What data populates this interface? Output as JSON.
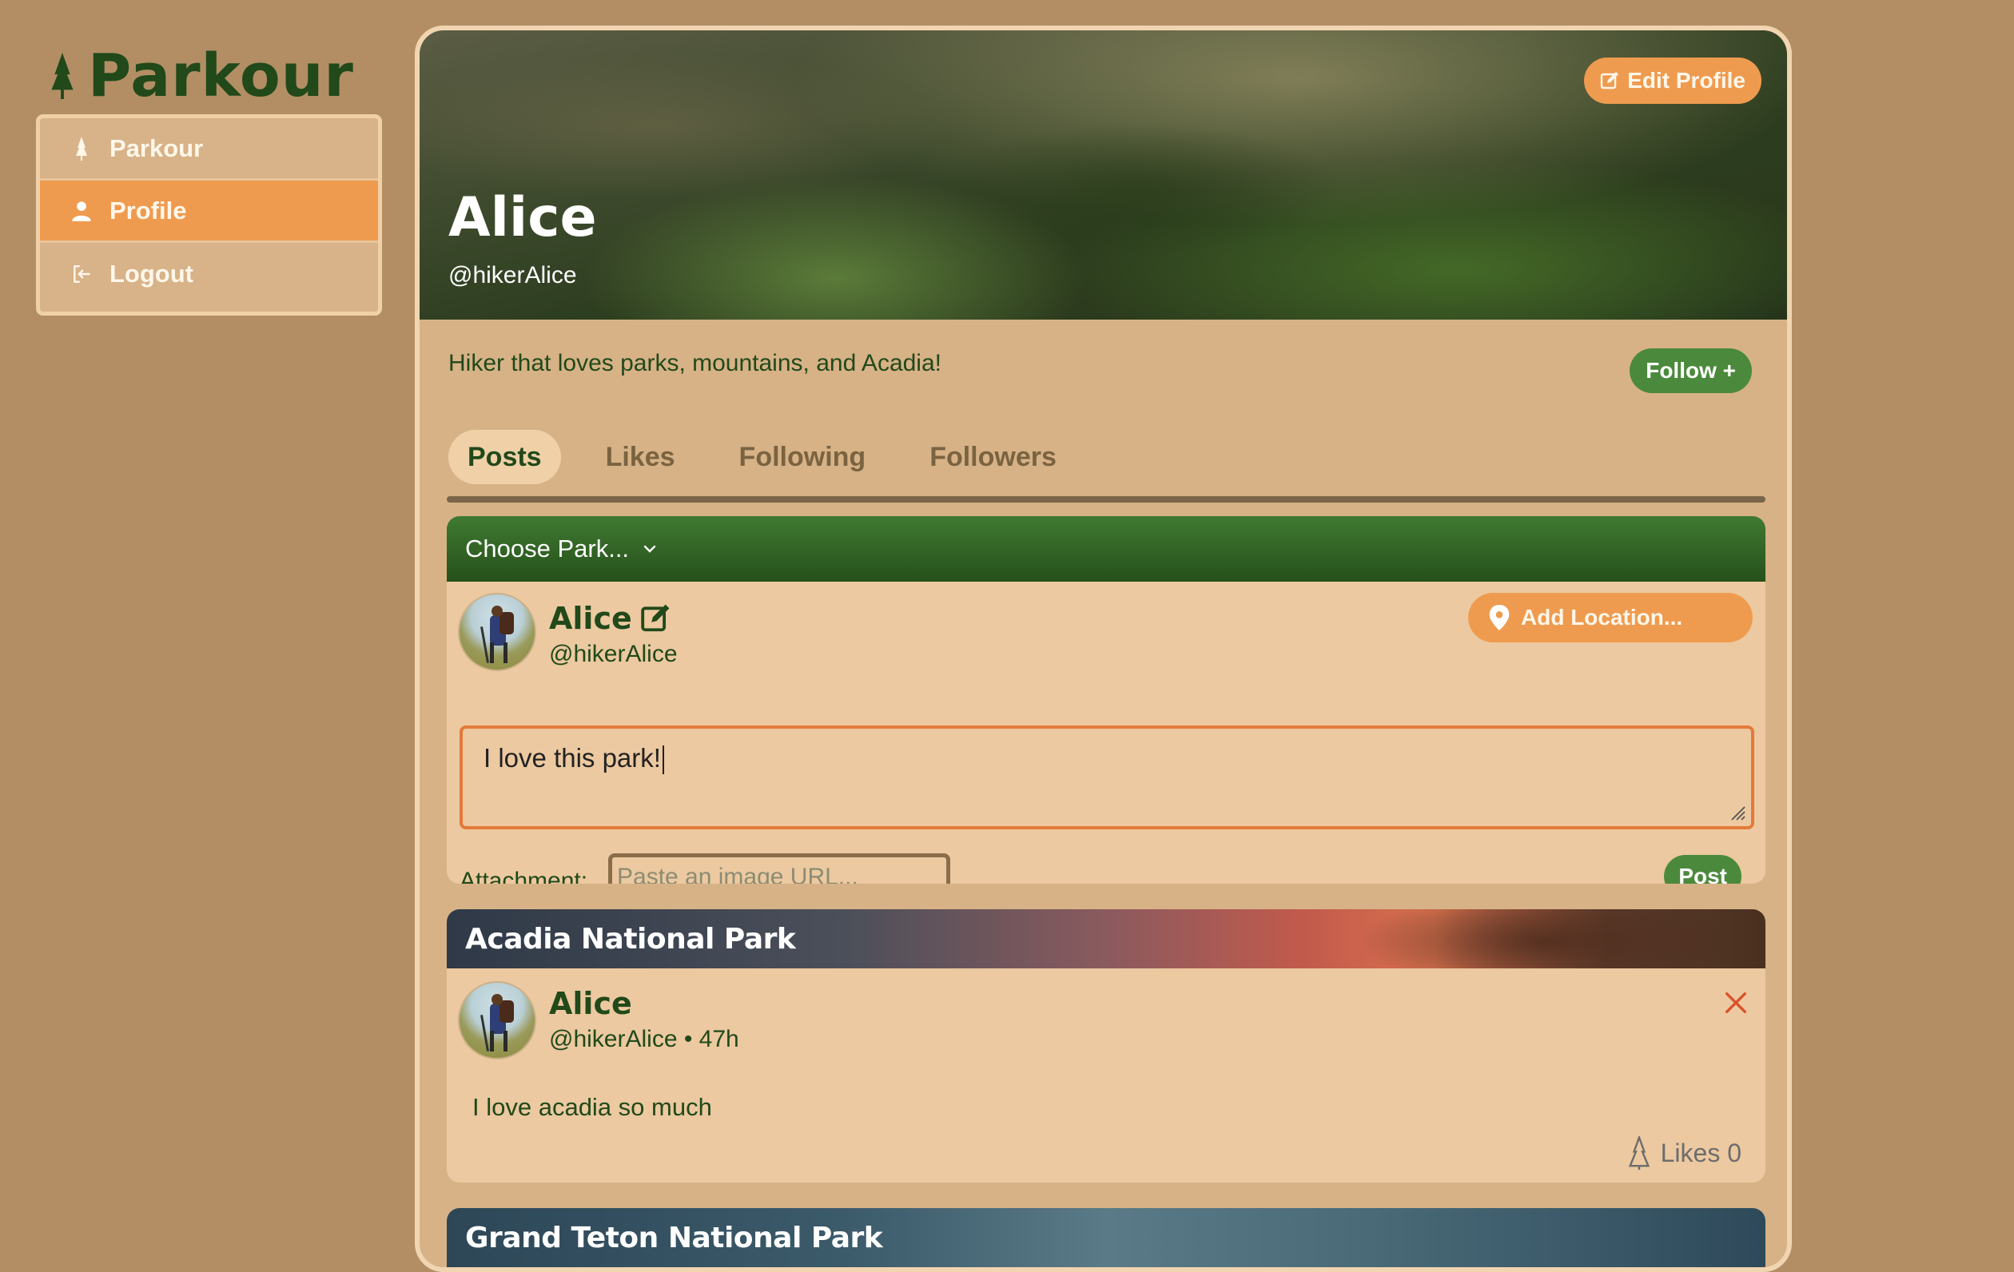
{
  "app": {
    "name": "Parkour"
  },
  "sidebar": {
    "items": [
      {
        "label": "Parkour",
        "icon": "tree-icon",
        "active": false
      },
      {
        "label": "Profile",
        "icon": "user-icon",
        "active": true
      },
      {
        "label": "Logout",
        "icon": "logout-icon",
        "active": false
      }
    ]
  },
  "profile": {
    "name": "Alice",
    "handle": "@hikerAlice",
    "bio": "Hiker that loves parks, mountains, and Acadia!",
    "edit_label": "Edit Profile",
    "follow_label": "Follow +"
  },
  "tabs": [
    {
      "label": "Posts",
      "active": true
    },
    {
      "label": "Likes",
      "active": false
    },
    {
      "label": "Following",
      "active": false
    },
    {
      "label": "Followers",
      "active": false
    }
  ],
  "composer": {
    "park_select": "Choose Park...",
    "author_name": "Alice",
    "author_handle": "@hikerAlice",
    "add_location_label": "Add Location...",
    "text_value": "I love this park!",
    "attachment_label": "Attachment:",
    "attachment_placeholder": "Paste an image URL...",
    "post_label": "Post"
  },
  "posts": [
    {
      "park": "Acadia National Park",
      "author_name": "Alice",
      "author_meta": "@hikerAlice • 47h",
      "body": "I love acadia so much",
      "likes_label": "Likes 0"
    },
    {
      "park": "Grand Teton National Park"
    }
  ],
  "colors": {
    "background": "#b38e64",
    "accent_orange": "#ef9b4f",
    "brand_green": "#21491a",
    "button_green": "#4b8a3c",
    "card": "#ecc9a0"
  }
}
